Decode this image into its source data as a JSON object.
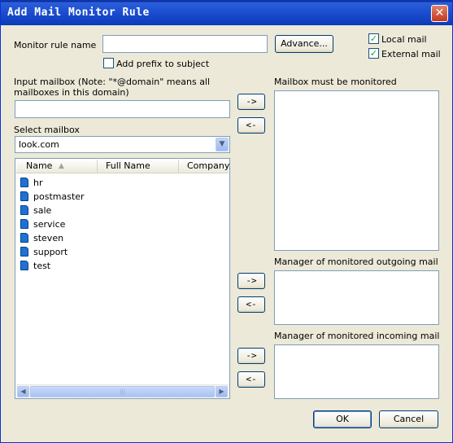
{
  "window": {
    "title": "Add Mail Monitor Rule",
    "close_glyph": "✕"
  },
  "monitor_rule": {
    "name_label": "Monitor rule name",
    "name_value": "",
    "advance_label": "Advance...",
    "prefix_label": "Add prefix to subject",
    "prefix_checked": false,
    "local_mail_label": "Local mail",
    "local_mail_checked": true,
    "external_mail_label": "External mail",
    "external_mail_checked": true
  },
  "input_mailbox": {
    "label": "Input mailbox (Note: \"*@domain\" means all mailboxes in this domain)",
    "value": ""
  },
  "select_mailbox": {
    "label": "Select mailbox",
    "selected": "look.com",
    "columns": [
      "Name",
      "Full Name",
      "Company/D"
    ],
    "rows": [
      "hr",
      "postmaster",
      "sale",
      "service",
      "steven",
      "support",
      "test"
    ]
  },
  "monitored": {
    "label": "Mailbox must be monitored",
    "add_label": "->",
    "remove_label": "<-"
  },
  "outgoing": {
    "label": "Manager of monitored outgoing mail",
    "add_label": "->",
    "remove_label": "<-"
  },
  "incoming": {
    "label": "Manager of monitored incoming mail",
    "add_label": "->",
    "remove_label": "<-"
  },
  "footer": {
    "ok_label": "OK",
    "cancel_label": "Cancel"
  },
  "icons": {
    "check": "✓",
    "dropdown": "▼",
    "sort": "▲",
    "scroll_left": "◀",
    "scroll_right": "▶",
    "scroll_grip": "|||"
  }
}
